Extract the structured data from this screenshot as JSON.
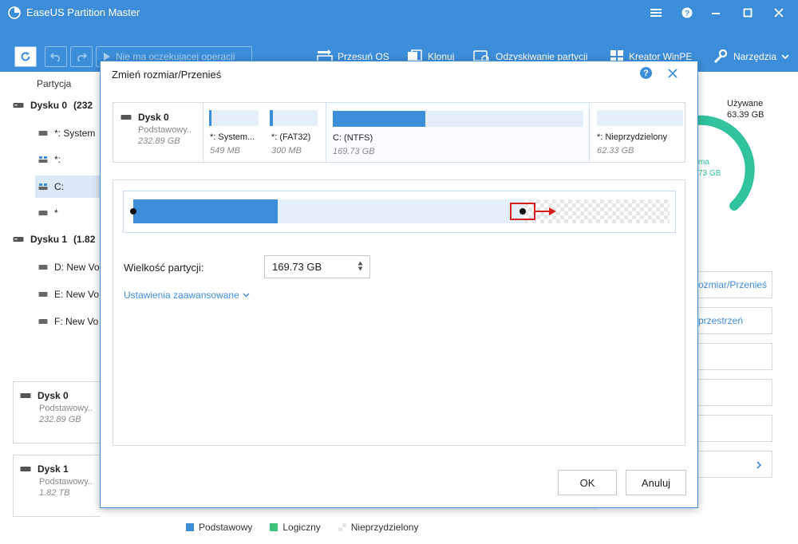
{
  "app": {
    "title": "EaseUS Partition Master"
  },
  "toolbar": {
    "pending": "Nie ma oczekujacej operacji",
    "items": [
      {
        "label": "Przesuń OS",
        "icon": "migrate-os-icon"
      },
      {
        "label": "Klonuj",
        "icon": "clone-icon"
      },
      {
        "label": "Odzyskiwanie partycji",
        "icon": "partition-recovery-icon"
      },
      {
        "label": "Kreator WinPE",
        "icon": "winpe-icon"
      },
      {
        "label": "Narzędzia",
        "icon": "tools-icon"
      }
    ]
  },
  "left": {
    "column_header": "Partycja",
    "disk0_label": "Dysku 0",
    "disk0_extra": "(232",
    "disk1_label": "Dysku 1",
    "disk1_extra": "(1.82",
    "partitions0": [
      "*: System",
      "*:",
      "C:",
      "*"
    ],
    "partitions1": [
      "D: New Vo",
      "E: New Vo",
      "F: New Vo"
    ],
    "cards": [
      {
        "name": "Dysk 0",
        "type": "Podstawowy..",
        "size": "232.89 GB"
      },
      {
        "name": "Dysk 1",
        "type": "Podstawowy..",
        "size": "1.82 TB"
      }
    ]
  },
  "right": {
    "used_label": "Używane",
    "used_value": "63.39 GB",
    "gauge_text1": "ma",
    "gauge_text2": "73 GB",
    "buttons": [
      "ozmiar/Przenieś",
      "przestrzeń",
      "",
      "",
      "",
      ""
    ],
    "colors": {
      "gauge": "#30c39e",
      "accent": "#3d8eda"
    }
  },
  "legend": {
    "items": [
      {
        "label": "Podstawowy",
        "color": "#3d8eda"
      },
      {
        "label": "Logiczny",
        "color": "#3ec37a"
      },
      {
        "label": "Nieprzydzielony",
        "color": "#e0e0e0"
      }
    ]
  },
  "dialog": {
    "title": "Zmień rozmiar/Przenieś",
    "help": "?",
    "disk": {
      "name": "Dysk 0",
      "type": "Podstawowy..",
      "size": "232.89 GB"
    },
    "partitions": [
      {
        "label": "*: System...",
        "size": "549 MB",
        "used_fraction": 0.12
      },
      {
        "label": "*:  (FAT32)",
        "size": "300 MB",
        "used_fraction": 0.08
      },
      {
        "label": "C:  (NTFS)",
        "size": "169.73 GB",
        "used_fraction": 0.37
      },
      {
        "label": "*: Nieprzydzielony",
        "size": "62.33 GB"
      }
    ],
    "size_label": "Wielkość partycji:",
    "size_value": "169.73 GB",
    "advanced_link": "Ustawienia zaawansowane",
    "ok": "OK",
    "cancel": "Anuluj",
    "slider": {
      "used_fraction": 0.27,
      "partition_fraction": 0.73
    }
  }
}
